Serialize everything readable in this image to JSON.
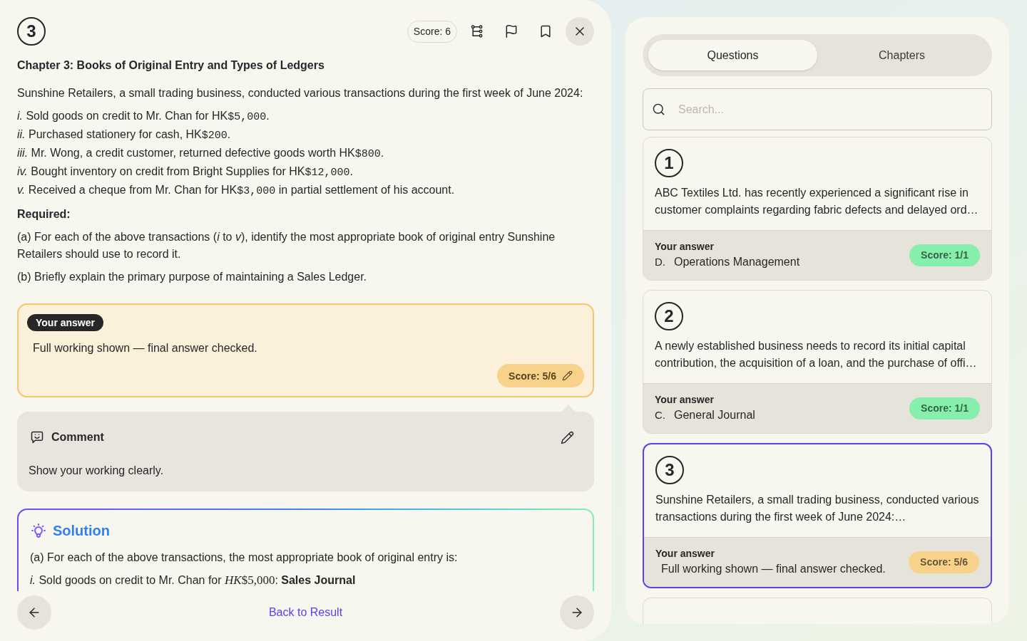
{
  "header": {
    "number": "3",
    "score": "Score: 6"
  },
  "chapter_title": "Chapter 3: Books of Original Entry and Types of Ledgers",
  "question": {
    "intro": "Sunshine Retailers, a small trading business, conducted various transactions during the first week of June 2024:",
    "items": [
      {
        "segments": [
          {
            "kind": "italic",
            "text": "i."
          },
          {
            "kind": "text",
            "text": " Sold goods on credit to Mr. Chan for HK"
          },
          {
            "kind": "code",
            "text": "$5,000"
          },
          {
            "kind": "text",
            "text": "."
          }
        ]
      },
      {
        "segments": [
          {
            "kind": "italic",
            "text": "ii."
          },
          {
            "kind": "text",
            "text": " Purchased stationery for cash, HK"
          },
          {
            "kind": "code",
            "text": "$200"
          },
          {
            "kind": "text",
            "text": "."
          }
        ]
      },
      {
        "segments": [
          {
            "kind": "italic",
            "text": "iii."
          },
          {
            "kind": "text",
            "text": " Mr. Wong, a credit customer, returned defective goods worth HK"
          },
          {
            "kind": "code",
            "text": "$800"
          },
          {
            "kind": "text",
            "text": "."
          }
        ]
      },
      {
        "segments": [
          {
            "kind": "italic",
            "text": "iv."
          },
          {
            "kind": "text",
            "text": " Bought inventory on credit from Bright Supplies for HK"
          },
          {
            "kind": "code",
            "text": "$12,000"
          },
          {
            "kind": "text",
            "text": "."
          }
        ]
      },
      {
        "segments": [
          {
            "kind": "italic",
            "text": "v."
          },
          {
            "kind": "text",
            "text": " Received a cheque from Mr. Chan for HK"
          },
          {
            "kind": "code",
            "text": "$3,000"
          },
          {
            "kind": "text",
            "text": " in partial settlement of his account."
          }
        ]
      }
    ],
    "required_label": "Required:",
    "parts": [
      "(a) For each of the above transactions (*i* to *v*), identify the most appropriate book of original entry Sunshine Retailers should use to record it.",
      "(b) Briefly explain the primary purpose of maintaining a Sales Ledger."
    ]
  },
  "answer": {
    "label": "Your answer",
    "text": "Full working shown — final answer checked.",
    "score": "Score: 5/6",
    "color": "#f8d28a"
  },
  "comment": {
    "title": "Comment",
    "text": "Show your working clearly."
  },
  "solution": {
    "title": "Solution",
    "lines": [
      {
        "segments": [
          {
            "kind": "text",
            "text": "(a) For each of the above transactions, the most appropriate book of original entry is:"
          }
        ]
      },
      {
        "segments": [
          {
            "kind": "italic",
            "text": "i."
          },
          {
            "kind": "text",
            "text": " Sold goods on credit to Mr. Chan for "
          },
          {
            "kind": "math_var",
            "text": "HK"
          },
          {
            "kind": "math",
            "text": "$5,000"
          },
          {
            "kind": "text",
            "text": ": "
          },
          {
            "kind": "bold",
            "text": "Sales Journal"
          }
        ]
      }
    ]
  },
  "footer": {
    "back_link": "Back to Result"
  },
  "sidebar": {
    "tabs": [
      {
        "label": "Questions",
        "selected": true
      },
      {
        "label": "Chapters",
        "selected": false
      }
    ],
    "search": {
      "placeholder": "Search..."
    },
    "questions": [
      {
        "number": "1",
        "text": "ABC Textiles Ltd. has recently experienced a significant rise in customer complaints regarding fabric defects and delayed ord…",
        "answer_label": "Your answer",
        "option": "D.",
        "answer": "Operations Management",
        "score": "Score: 1/1",
        "color": "#86efac",
        "selected": false
      },
      {
        "number": "2",
        "text": "A newly established business needs to record its initial capital contribution, the acquisition of a loan, and the purchase of offi…",
        "answer_label": "Your answer",
        "option": "C.",
        "answer": "General Journal",
        "score": "Score: 1/1",
        "color": "#86efac",
        "selected": false
      },
      {
        "number": "3",
        "text": "Sunshine Retailers, a small trading business, conducted various transactions during the first week of June 2024:…",
        "answer_label": "Your answer",
        "answer": "Full working shown — final answer checked.",
        "score": "Score: 5/6",
        "color": "#f8d28a",
        "selected": true
      }
    ]
  }
}
